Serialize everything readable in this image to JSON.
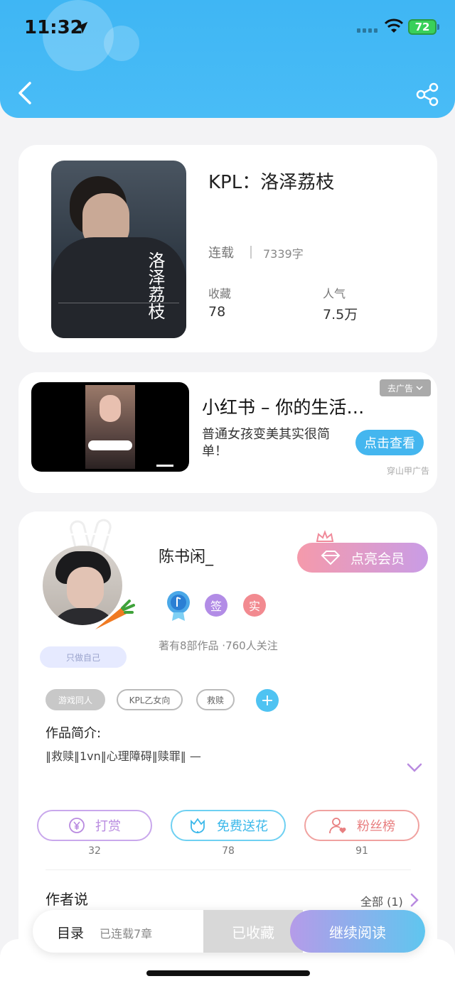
{
  "status_bar": {
    "time": "11:32",
    "battery": "72"
  },
  "book": {
    "title": "KPL：洛泽荔枝",
    "cover_title": "洛泽荔枝",
    "status": "连载",
    "word_count": "7339字",
    "favorites_label": "收藏",
    "favorites_value": "78",
    "popularity_label": "人气",
    "popularity_value": "7.5万"
  },
  "ad": {
    "title": "小红书 – 你的生活…",
    "description": "普通女孩变美其实很简单！",
    "dismiss_label": "去广告",
    "cta_label": "点击查看",
    "source": "穿山甲广告"
  },
  "author": {
    "name": "陈书闲_",
    "vip_label": "点亮会员",
    "sign_badge": "签",
    "real_badge": "实",
    "sticker_label": "只做自己",
    "stats": "著有8部作品 ·760人关注",
    "tags": [
      "游戏同人",
      "KPL乙女向",
      "救赎"
    ],
    "tag_add": "+",
    "intro_label": "作品简介:",
    "intro_text": "‖救赎‖1vn‖心理障碍‖赎罪‖ —"
  },
  "actions": [
    {
      "label": "打赏",
      "count": "32",
      "icon": "yen-icon"
    },
    {
      "label": "免费送花",
      "count": "78",
      "icon": "flower-icon"
    },
    {
      "label": "粉丝榜",
      "count": "91",
      "icon": "fan-user-icon"
    }
  ],
  "author_say": {
    "label": "作者说",
    "all_label": "全部 (1)"
  },
  "bottom_bar": {
    "toc_label": "目录",
    "toc_status": "已连载7章",
    "collected_label": "已收藏",
    "continue_label": "继续阅读"
  },
  "colors": {
    "header": "#3fb6f4",
    "vip_gradient_start": "#f59aab",
    "vip_gradient_end": "#c99ce6",
    "continue_gradient_start": "#b59be9",
    "continue_gradient_end": "#5fc6ef"
  }
}
